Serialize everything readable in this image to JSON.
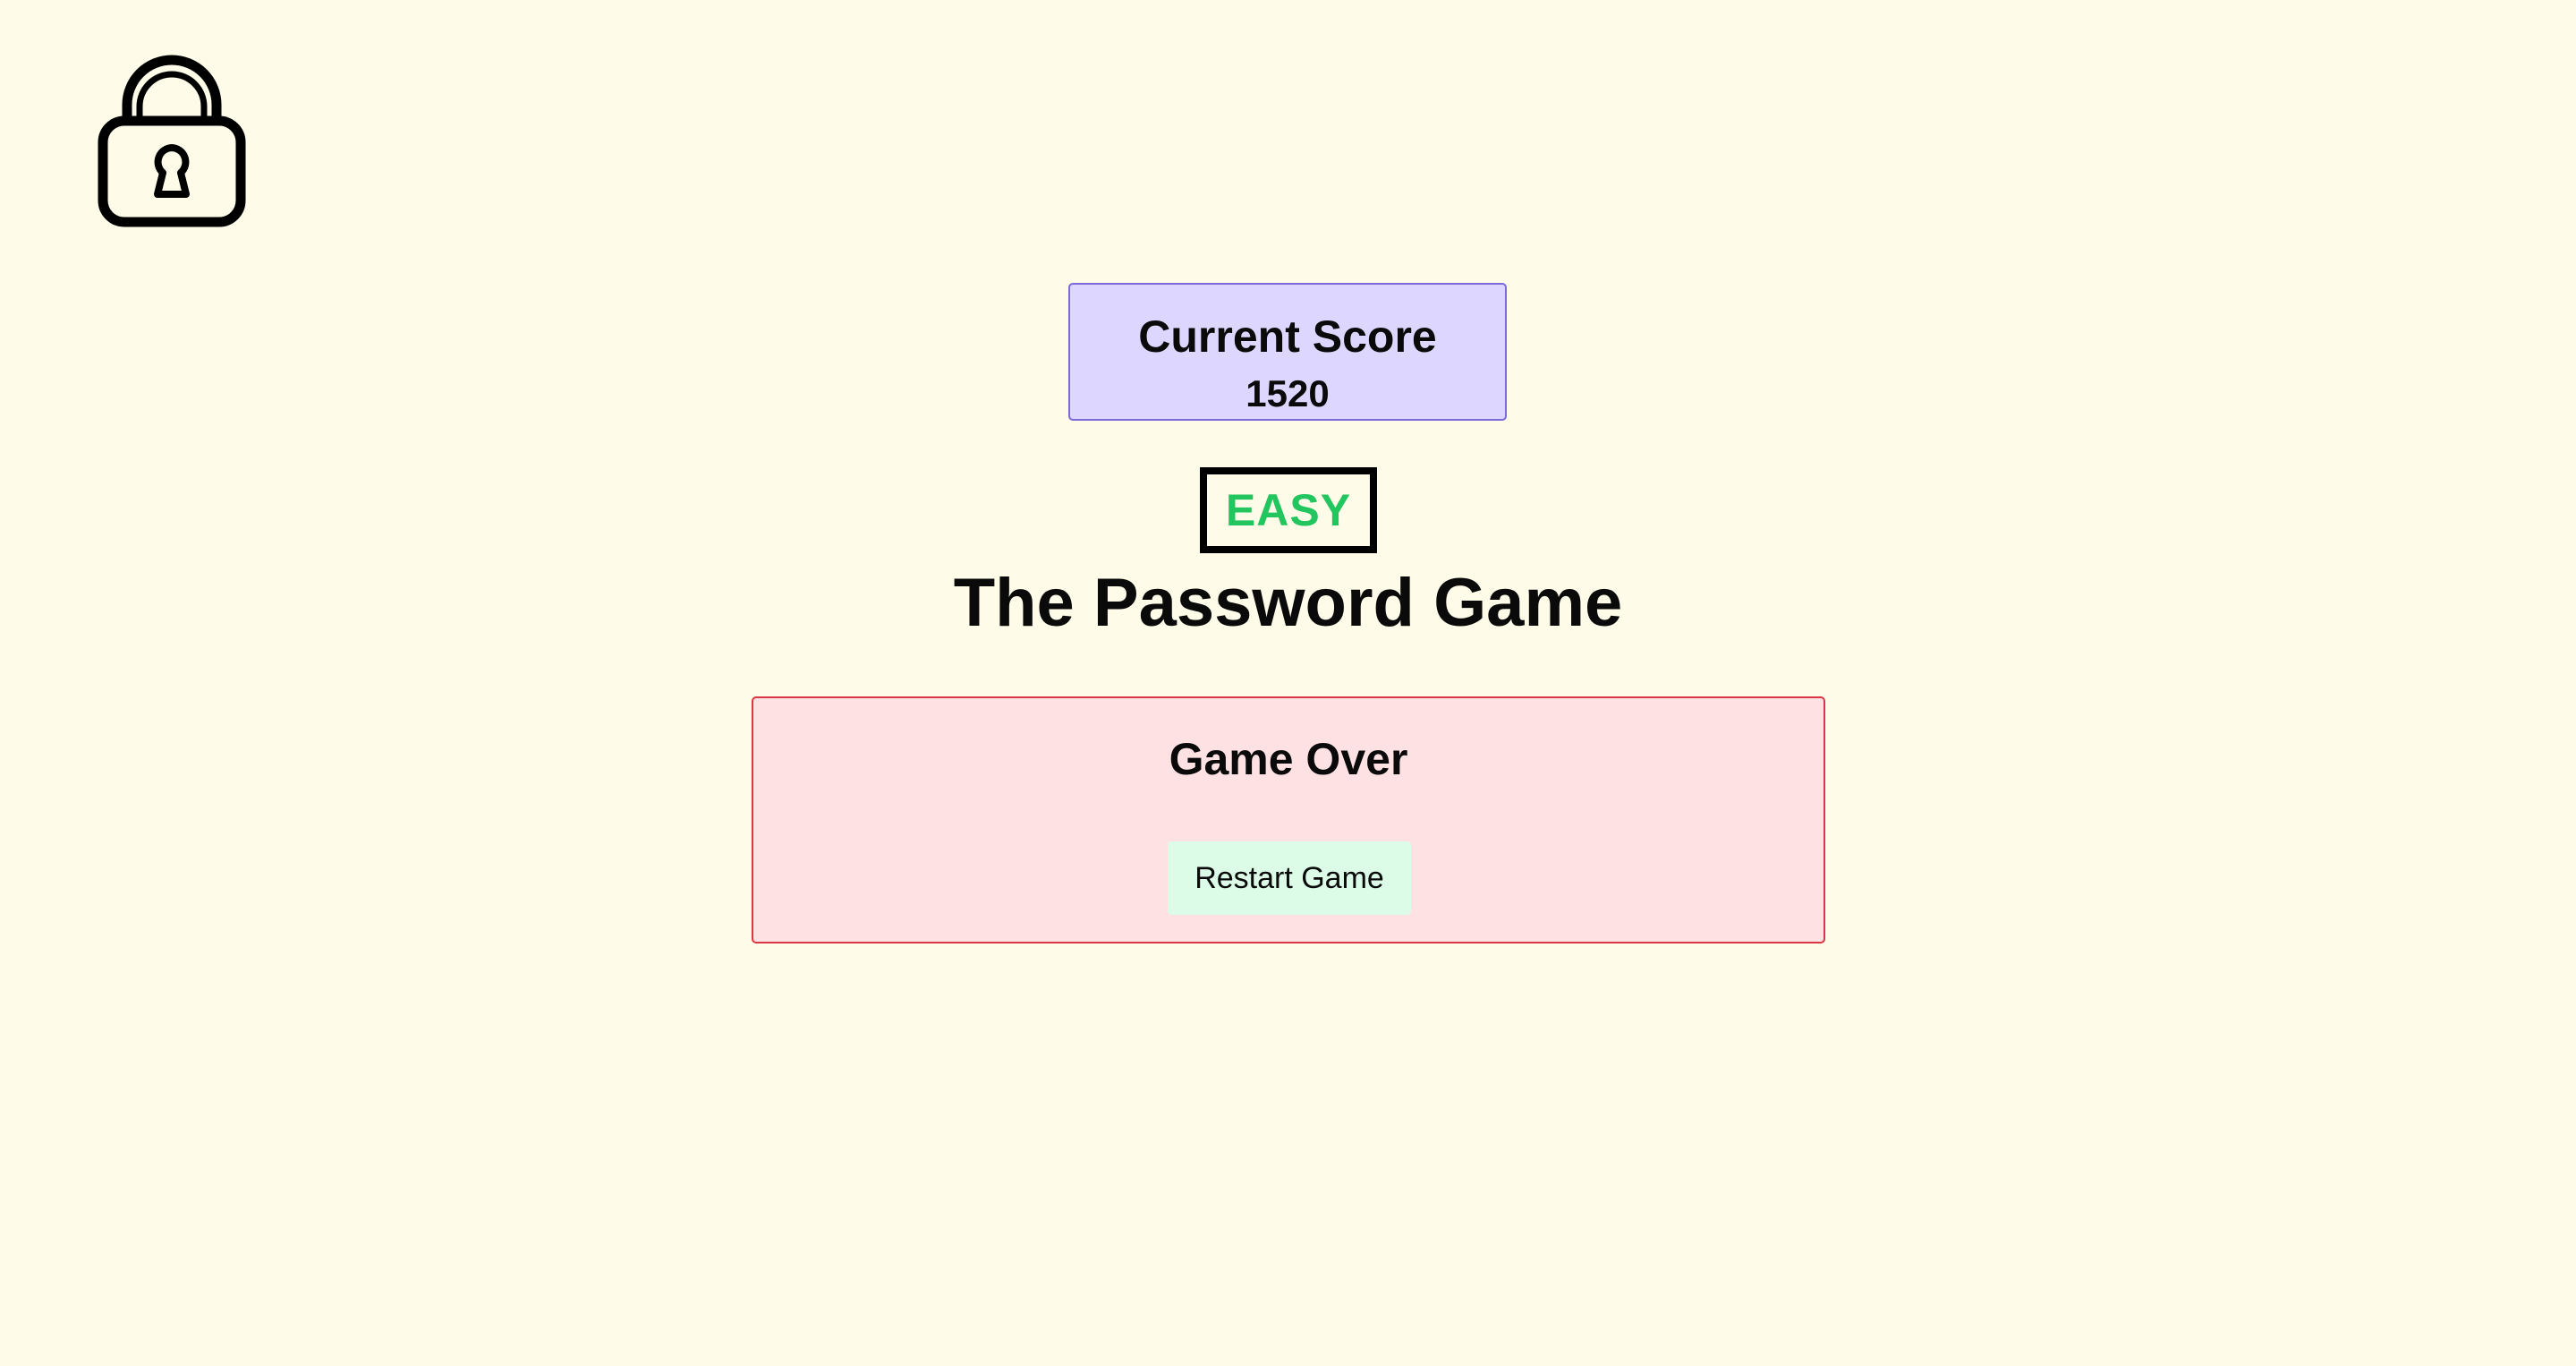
{
  "logo": {
    "icon": "lock-icon"
  },
  "score": {
    "title": "Current Score",
    "value": "1520"
  },
  "difficulty": {
    "label": "EASY",
    "color": "#22c55e"
  },
  "title": "The Password Game",
  "game_over": {
    "title": "Game Over",
    "restart_label": "Restart Game"
  },
  "colors": {
    "background": "#fefbe8",
    "score_box": "#ddd6fe",
    "score_border": "#7c6ad8",
    "panel": "#fee1e3",
    "panel_border": "#dc3545",
    "button": "#dcfce7"
  }
}
